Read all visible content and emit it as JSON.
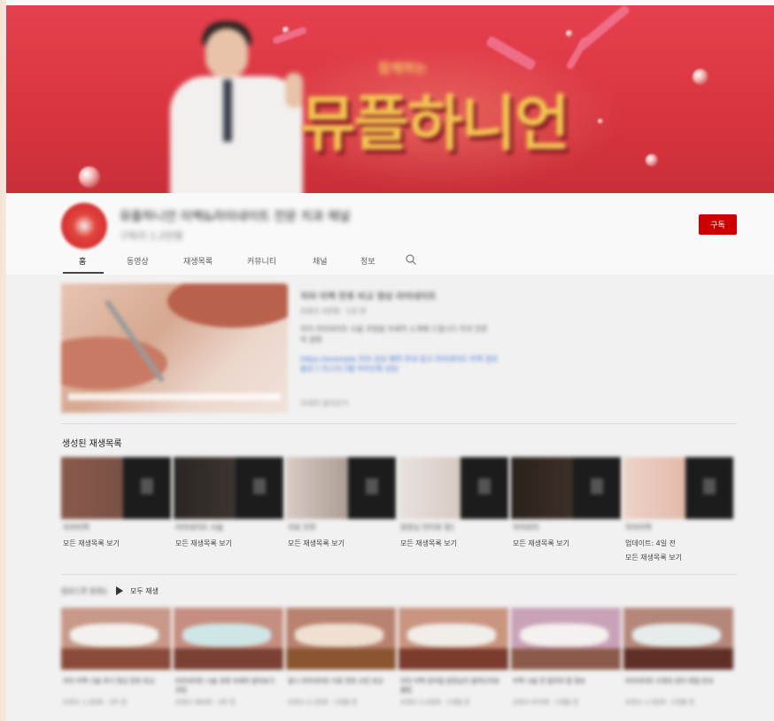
{
  "banner": {
    "headline_art": "뮤플하니언",
    "subtitle_art": "함께하는"
  },
  "channel": {
    "name": "뮤플하니언 미백&라미네이트 전문 치과 채널",
    "subscribers": "구독자 1.2만명",
    "subscribe_label": "구독"
  },
  "tabs": [
    {
      "label": "홈",
      "active": true
    },
    {
      "label": "동영상"
    },
    {
      "label": "재생목록"
    },
    {
      "label": "커뮤니티"
    },
    {
      "label": "채널"
    },
    {
      "label": "정보"
    }
  ],
  "featured": {
    "title": "치아 미백 전후 비교 영상 라미네이트",
    "meta": "조회수 5만회 · 1년 전",
    "description": "치아 라미네이트 시술 과정을 자세히 소개해 드립니다 치과 전문의 설명",
    "links": "https://example 치과 상담 예약 안내 링크 라미네이트 미백 정보 블로그 인스타그램 카카오톡 상담",
    "more": "자세히 알아보기"
  },
  "created_playlists": {
    "title": "생성된 재생목록",
    "items": [
      {
        "name": "치아미백",
        "link": "모든 재생목록 보기"
      },
      {
        "name": "라미네이트 시술",
        "link": "모든 재생목록 보기"
      },
      {
        "name": "치료 전후",
        "link": "모든 재생목록 보기"
      },
      {
        "name": "원장님 인터뷰 영상",
        "link": "모든 재생목록 보기"
      },
      {
        "name": "치아관리",
        "link": "모든 재생목록 보기"
      },
      {
        "name": "치아미백",
        "updated": "업데이트: 4일 전",
        "link": "모든 재생목록 보기"
      }
    ]
  },
  "uploads": {
    "title": "업로드한 동영상",
    "play_all": "모두 재생",
    "videos": [
      {
        "title": "치아 미백 시술 후기 영상 전후 비교",
        "meta": "조회수 1.2천회 · 2주 전"
      },
      {
        "title": "라미네이트 시술 과정 자세히 알아보기 상담",
        "meta": "조회수 980회 · 3주 전"
      },
      {
        "title": "앞니 라미네이트 치료 전후 사진 비교",
        "meta": "조회수 2.1천회 · 1개월 전"
      },
      {
        "title": "치아 미백 관리법 원장님이 알려드려요 꿀팁",
        "meta": "조회수 3.4천회 · 1개월 전"
      },
      {
        "title": "미백 시술 전 알아야 할 정보",
        "meta": "조회수 870회 · 2개월 전"
      },
      {
        "title": "라미네이트 수명과 관리 방법 안내",
        "meta": "조회수 1.5천회 · 2개월 전"
      }
    ]
  },
  "colors": {
    "banner_red": "#d8343f",
    "subscribe_red": "#cc0000",
    "headline_gold": "#f3c651"
  }
}
